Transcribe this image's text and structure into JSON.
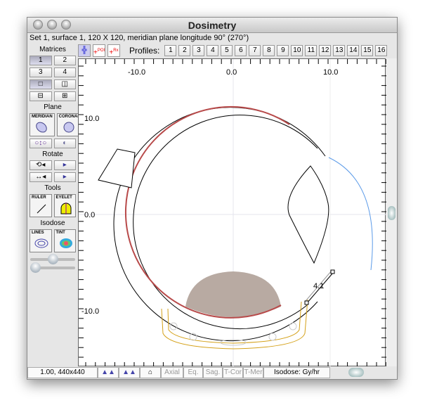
{
  "window": {
    "title": "Dosimetry",
    "info": "Set 1, surface 1, 120 X 120, meridian plane longitude 90° (270°)"
  },
  "sidebar": {
    "matrices_label": "Matrices",
    "matrix_buttons": [
      "1",
      "2",
      "3",
      "4"
    ],
    "plane_label": "Plane",
    "meridian": "MERIDIAN",
    "coronal": "CORONAL",
    "rotate_label": "Rotate",
    "tools_label": "Tools",
    "ruler": "RULER",
    "eyelet": "EYELET",
    "isodose_label": "Isodose",
    "lines": "LINES",
    "tint": "TINT",
    "slider1_value": 0.5,
    "slider2_value": 0.05
  },
  "toolbar": {
    "poi": "POI",
    "rx": "Rx",
    "profiles_label": "Profiles:",
    "profiles": [
      "1",
      "2",
      "3",
      "4",
      "5",
      "6",
      "7",
      "8",
      "9",
      "10",
      "11",
      "12",
      "13",
      "14",
      "15",
      "16"
    ]
  },
  "canvas": {
    "x_ticks": [
      "-10.0",
      "0.0",
      "10.0"
    ],
    "y_ticks": [
      "10.0",
      "0.0",
      "-10.0"
    ],
    "measure_label": "4.1"
  },
  "status": {
    "zoom": "1.00, 440x440",
    "views": [
      "Axial",
      "Eq.",
      "Sag.",
      "T-Cor",
      "T-Mer"
    ],
    "isodose": "Isodose: Gy/hr"
  },
  "colors": {
    "retina": "#b84a4a",
    "cornea": "#5a9ae8",
    "tumor": "#b8aaa2",
    "plaque": "#d4a017"
  }
}
